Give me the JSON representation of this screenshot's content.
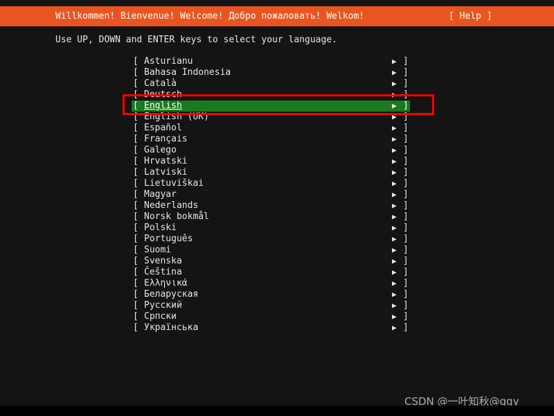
{
  "banner": {
    "title": "Willkommen! Bienvenue! Welcome! Добро пожаловать! Welkom!",
    "help_label": "[ Help ]",
    "background_color": "#e9551f",
    "text_color": "#ffffff"
  },
  "instruction": "Use UP, DOWN and ENTER keys to select your language.",
  "list": {
    "bracket_open": "[",
    "bracket_close": "]",
    "arrow_icon": "▶",
    "selected_index": 4,
    "highlight_color": "#1a7a1f",
    "items": [
      {
        "label": "Asturianu"
      },
      {
        "label": "Bahasa Indonesia"
      },
      {
        "label": "Català"
      },
      {
        "label": "Deutsch"
      },
      {
        "label": "English"
      },
      {
        "label": "English (UK)"
      },
      {
        "label": "Español"
      },
      {
        "label": "Français"
      },
      {
        "label": "Galego"
      },
      {
        "label": "Hrvatski"
      },
      {
        "label": "Latviski"
      },
      {
        "label": "Lietuviškai"
      },
      {
        "label": "Magyar"
      },
      {
        "label": "Nederlands"
      },
      {
        "label": "Norsk bokmål"
      },
      {
        "label": "Polski"
      },
      {
        "label": "Português"
      },
      {
        "label": "Suomi"
      },
      {
        "label": "Svenska"
      },
      {
        "label": "Čeština"
      },
      {
        "label": "Ελληνικά"
      },
      {
        "label": "Беларуская"
      },
      {
        "label": "Русский"
      },
      {
        "label": "Српски"
      },
      {
        "label": "Українська"
      }
    ]
  },
  "annotation": {
    "color": "#ff0000"
  },
  "watermark": "CSDN @一叶知秋@qqy"
}
